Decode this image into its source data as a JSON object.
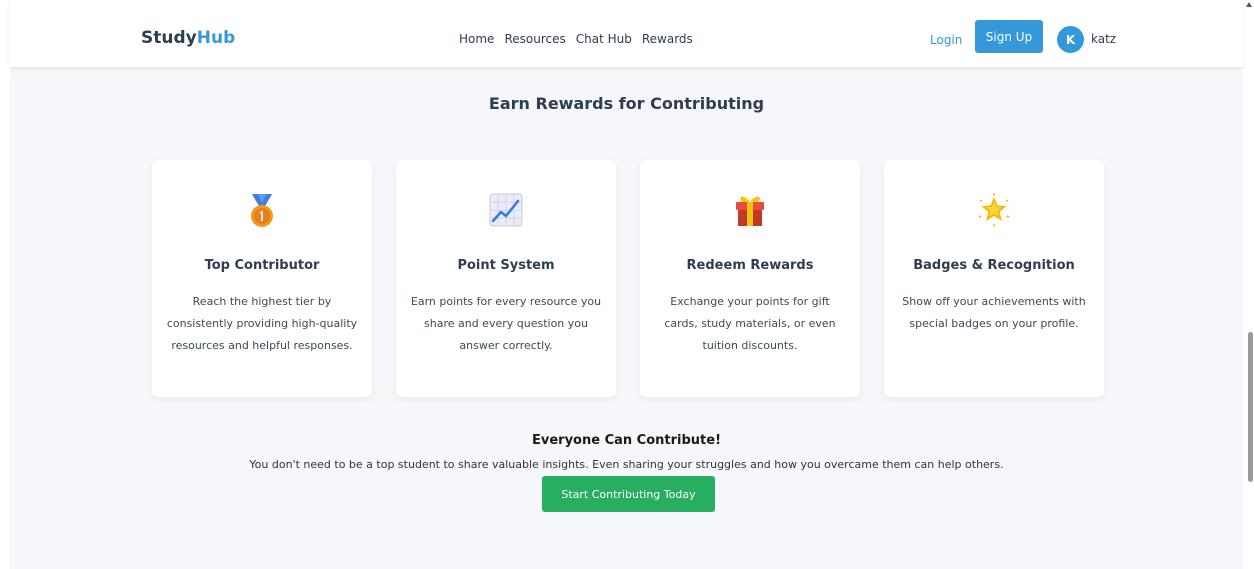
{
  "brand": {
    "name_part1": "Study",
    "name_part2": "Hub"
  },
  "nav": [
    {
      "label": "Home"
    },
    {
      "label": "Resources"
    },
    {
      "label": "Chat Hub"
    },
    {
      "label": "Rewards"
    }
  ],
  "auth": {
    "login": "Login",
    "signup": "Sign Up"
  },
  "user": {
    "initial": "K",
    "name": "katz"
  },
  "section": {
    "title": "Earn Rewards for Contributing"
  },
  "cards": [
    {
      "icon": "medal-icon",
      "title": "Top Contributor",
      "text": "Reach the highest tier by consistently providing high-quality resources and helpful responses."
    },
    {
      "icon": "chart-increasing-icon",
      "title": "Point System",
      "text": "Earn points for every resource you share and every question you answer correctly."
    },
    {
      "icon": "gift-icon",
      "title": "Redeem Rewards",
      "text": "Exchange your points for gift cards, study materials, or even tuition discounts."
    },
    {
      "icon": "glowing-star-icon",
      "title": "Badges & Recognition",
      "text": "Show off your achievements with special badges on your profile."
    }
  ],
  "cta": {
    "title": "Everyone Can Contribute!",
    "text": "You don't need to be a top student to share valuable insights. Even sharing your struggles and how you overcame them can help others.",
    "button": "Start Contributing Today"
  },
  "colors": {
    "primary": "#3498db",
    "success": "#27ae60",
    "text": "#2c3e50",
    "background": "#f5f7fa"
  }
}
